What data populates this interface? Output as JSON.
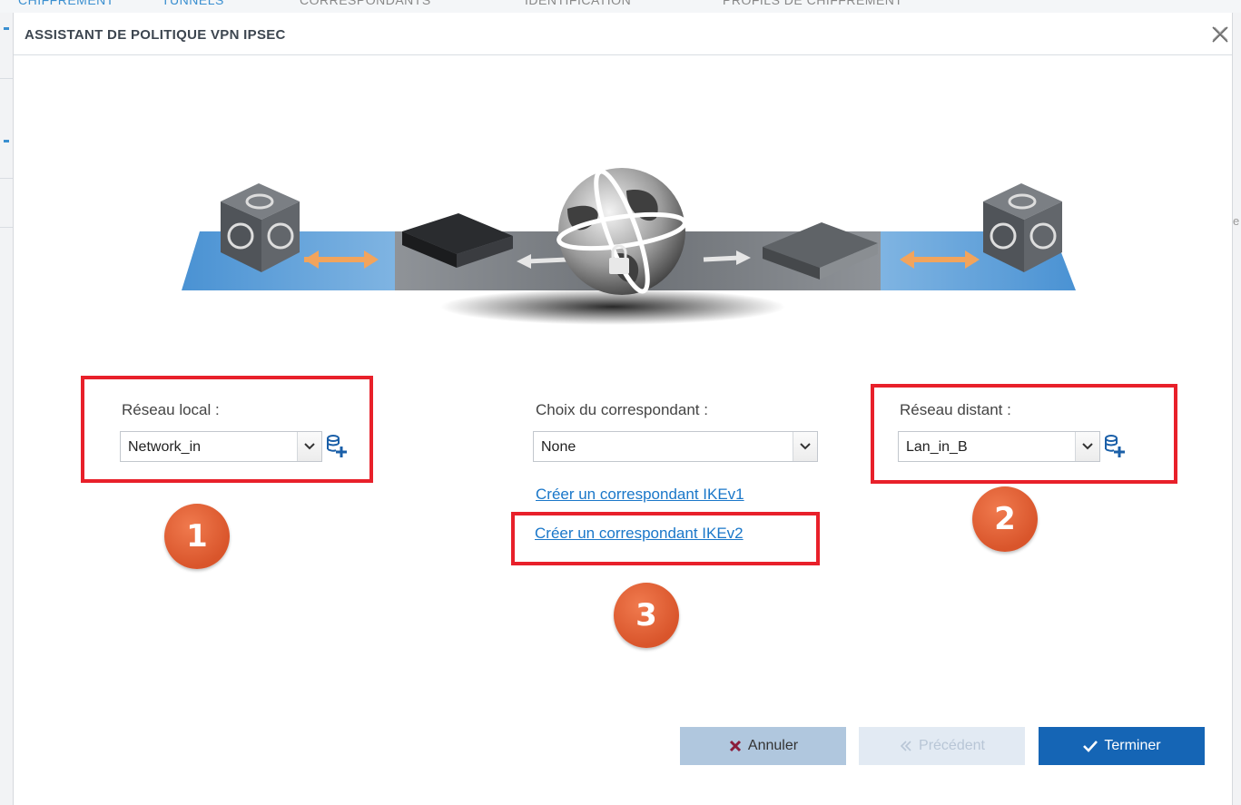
{
  "background": {
    "tabs": [
      "CHIFFREMENT",
      "TUNNELS",
      "CORRESPONDANTS",
      "IDENTIFICATION",
      "PROFILS DE CHIFFREMENT"
    ]
  },
  "dialog": {
    "title": "ASSISTANT DE POLITIQUE VPN IPSEC"
  },
  "local_network": {
    "label": "Réseau local :",
    "value": "Network_in"
  },
  "peer": {
    "label": "Choix du correspondant :",
    "value": "None",
    "link_ikev1": "Créer un correspondant IKEv1",
    "link_ikev2": "Créer un correspondant IKEv2"
  },
  "remote_network": {
    "label": "Réseau distant :",
    "value": "Lan_in_B"
  },
  "badges": [
    "1",
    "2",
    "3"
  ],
  "buttons": {
    "cancel": "Annuler",
    "previous": "Précédent",
    "finish": "Terminer"
  },
  "colors": {
    "highlight": "#e8202a",
    "badge": "#d9552b",
    "link": "#1a77c9",
    "primary": "#1565b5"
  }
}
